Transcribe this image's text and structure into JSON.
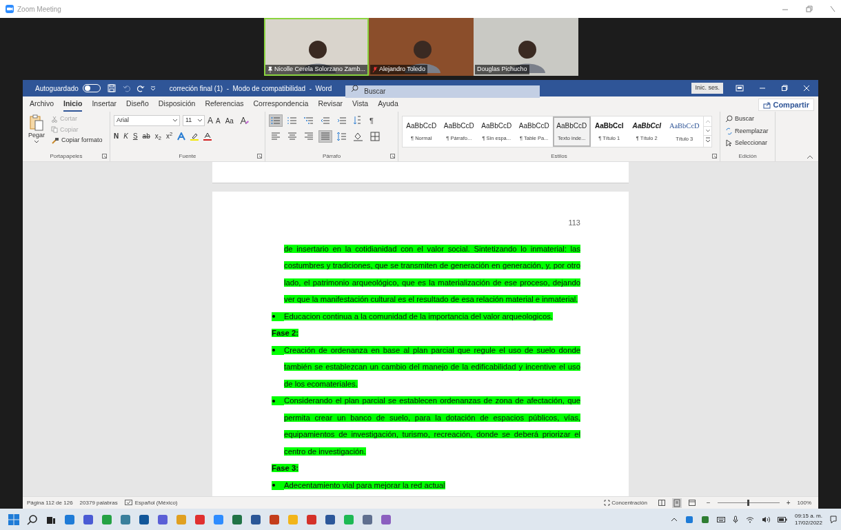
{
  "zoom_window": {
    "title": "Zoom Meeting"
  },
  "participants": [
    {
      "name": "Nicolle Cerela Solorzano Zamb...",
      "pinned": true,
      "muted": false,
      "speaking": true,
      "kind": "light"
    },
    {
      "name": "Alejandro Toledo",
      "pinned": false,
      "muted": true,
      "speaking": false,
      "kind": "wood"
    },
    {
      "name": "Douglas Pichucho",
      "pinned": false,
      "muted": false,
      "speaking": false,
      "kind": "room"
    }
  ],
  "word_title_bar": {
    "autosave_label": "Autoguardado",
    "autosave_on": false,
    "document_title": "correción final (1)  -  Modo de compatibilidad  -  Word",
    "search_placeholder": "Buscar",
    "sign_in": "Inic. ses."
  },
  "ribbon_tabs": [
    {
      "label": "Archivo",
      "selected": false
    },
    {
      "label": "Inicio",
      "selected": true
    },
    {
      "label": "Insertar",
      "selected": false
    },
    {
      "label": "Diseño",
      "selected": false
    },
    {
      "label": "Disposición",
      "selected": false
    },
    {
      "label": "Referencias",
      "selected": false
    },
    {
      "label": "Correspondencia",
      "selected": false
    },
    {
      "label": "Revisar",
      "selected": false
    },
    {
      "label": "Vista",
      "selected": false
    },
    {
      "label": "Ayuda",
      "selected": false
    }
  ],
  "share_button": "Compartir",
  "clipboard": {
    "paste": "Pegar",
    "cut": "Cortar",
    "cut_disabled": true,
    "copy": "Copiar",
    "copy_disabled": true,
    "format_painter": "Copiar formato",
    "group_label": "Portapapeles"
  },
  "font": {
    "family": "Arial",
    "size": "11",
    "grow": "A",
    "shrink": "A",
    "case": "Aa",
    "format_buttons": [
      {
        "label": "N",
        "kind": "bold"
      },
      {
        "label": "K",
        "kind": "italic"
      },
      {
        "label": "S",
        "kind": "underline"
      },
      {
        "label": "ab",
        "kind": "strike"
      },
      {
        "label": "x$_{2}$",
        "kind": "plain"
      },
      {
        "label": "x$^{2}$",
        "kind": "plain"
      }
    ],
    "group_label": "Fuente"
  },
  "paragraph": {
    "tools": [
      {
        "kind": "bullets",
        "selected": true
      },
      {
        "kind": "numbering",
        "selected": false
      },
      {
        "kind": "multilevel",
        "selected": false
      },
      {
        "kind": "outdent",
        "selected": false
      },
      {
        "kind": "indent",
        "selected": false
      },
      {
        "kind": "sort",
        "selected": false
      },
      {
        "kind": "pilcrow",
        "selected": false
      }
    ],
    "align": [
      {
        "kind": "left",
        "selected": false
      },
      {
        "kind": "center",
        "selected": false
      },
      {
        "kind": "right",
        "selected": false
      },
      {
        "kind": "justify",
        "selected": true
      },
      {
        "kind": "spacing",
        "selected": false
      },
      {
        "kind": "shading",
        "selected": false
      },
      {
        "kind": "borders",
        "selected": false
      }
    ],
    "pilcrow": "¶",
    "group_label": "Párrafo"
  },
  "styles": {
    "items": [
      {
        "preview": "AaBbCcD",
        "label": "¶ Normal",
        "kind": "normal",
        "selected": false
      },
      {
        "preview": "AaBbCcD",
        "label": "¶ Párrafo...",
        "kind": "normal",
        "selected": false
      },
      {
        "preview": "AaBbCcD",
        "label": "¶ Sin espa...",
        "kind": "normal",
        "selected": false
      },
      {
        "preview": "AaBbCcD",
        "label": "¶ Table Pa...",
        "kind": "normal",
        "selected": false
      },
      {
        "preview": "AaBbCcD",
        "label": "Texto inde...",
        "kind": "normal",
        "selected": true
      },
      {
        "preview": "AaBbCcI",
        "label": "¶ Título 1",
        "kind": "heading1",
        "selected": false
      },
      {
        "preview": "AaBbCcI",
        "label": "¶ Título 2",
        "kind": "heading2",
        "selected": false
      },
      {
        "preview": "AaBbCcD",
        "label": "Título 3",
        "kind": "heading3",
        "selected": false
      }
    ],
    "group_label": "Estilos"
  },
  "editing": {
    "find": "Buscar",
    "replace": "Reemplazar",
    "select": "Seleccionar",
    "group_label": "Edición"
  },
  "document": {
    "page_number": "113",
    "blocks": [
      {
        "kind": "paragraph",
        "highlighted": true,
        "text": "de insertario en la cotidianidad con el valor social. Sintetizando lo inmaterial: las costumbres y tradiciones, que se transmiten de generación en generación, y, por otro lado, el patrimonio arqueológico, que es la materialización de ese proceso, dejando ver que la manifestación cultural es el resultado de esa relación material e inmaterial."
      },
      {
        "kind": "bullet",
        "highlighted": true,
        "text": "Educacion continua a la comunidad de la importancia del valor arqueologicos."
      },
      {
        "kind": "heading",
        "highlighted": true,
        "text": "Fase 2:"
      },
      {
        "kind": "bullet",
        "highlighted": true,
        "text": "Creación de ordenanza en base al plan parcial que regule el uso de suelo donde también se establezcan un cambio del manejo de la edificabilidad y incentive el uso de los ecomateriales."
      },
      {
        "kind": "bullet",
        "highlighted": true,
        "text": "Considerando el plan parcial se establecen ordenanzas de zona de afectación,  que permita crear un banco de suelo, para la dotación de espacios públicos, vías, equipamientos de investigación, turismo, recreación, donde se deberá priorizar el centro de investigación."
      },
      {
        "kind": "heading",
        "highlighted": true,
        "text": "Fase 3:"
      },
      {
        "kind": "bullet",
        "highlighted": true,
        "text": "Adecentamiento vial para mejorar la red actual"
      }
    ]
  },
  "status_bar": {
    "page": "Página 112 de 126",
    "words": "20379 palabras",
    "language": "Español (México)",
    "focus": "Concentración",
    "zoom_out": "−",
    "zoom_in": "+",
    "zoom": "100%",
    "level": 0.5
  },
  "taskbar": {
    "time": "09:15 a. m.",
    "date": "17/02/2022"
  }
}
